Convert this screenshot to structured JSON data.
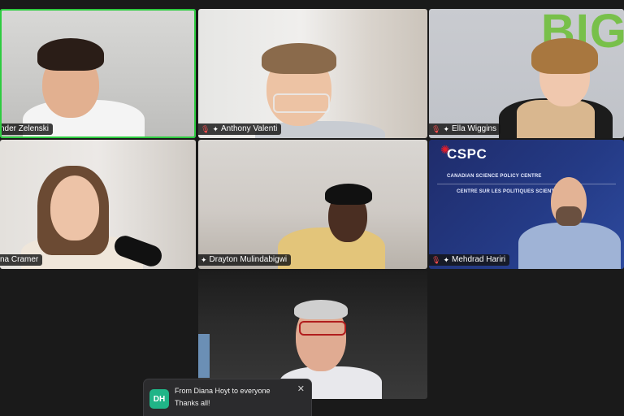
{
  "participants": [
    {
      "name": "nder Zelenski",
      "muted": false,
      "pinned": false,
      "active_speaker": true
    },
    {
      "name": "Anthony Valenti",
      "muted": true,
      "pinned": true,
      "active_speaker": false
    },
    {
      "name": "Ella Wiggins",
      "muted": true,
      "pinned": true,
      "active_speaker": false
    },
    {
      "name": "na Cramer",
      "muted": false,
      "pinned": false,
      "active_speaker": false
    },
    {
      "name": "Drayton Mulindabigwi",
      "muted": false,
      "pinned": true,
      "active_speaker": false
    },
    {
      "name": "Mehdrad Hariri",
      "muted": true,
      "pinned": true,
      "active_speaker": false
    }
  ],
  "backgrounds": {
    "ella_wall_text": "BIG",
    "cspc": {
      "logo": "CSPC",
      "line1": "CANADIAN SCIENCE POLICY CENTRE",
      "line2": "CENTRE SUR LES POLITIQUES SCIENTIFIQUES"
    }
  },
  "chat": {
    "avatar_initials": "DH",
    "from": "From Diana Hoyt to everyone",
    "message": "Thanks all!",
    "close_icon": "✕"
  },
  "colors": {
    "active_border": "#2ecc40",
    "mute_red": "#ff4d4d",
    "avatar_green": "#20b487",
    "cspc_blue": "#243a85"
  }
}
